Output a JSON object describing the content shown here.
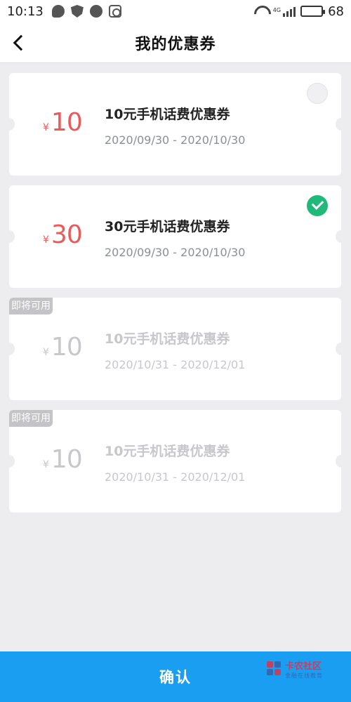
{
  "status_bar": {
    "time": "10:13",
    "net_type": "4G",
    "battery": "68",
    "battery_level": 0.68,
    "icons": [
      "message-bubble-icon",
      "shield-icon",
      "chat-dots-icon",
      "target-icon"
    ]
  },
  "nav": {
    "title": "我的优惠券",
    "back_icon": "chevron-left-icon"
  },
  "coupons": [
    {
      "currency": "¥",
      "amount": "10",
      "title": "10元手机话费优惠券",
      "date_range": "2020/09/30 - 2020/10/30",
      "state": "unselected"
    },
    {
      "currency": "¥",
      "amount": "30",
      "title": "30元手机话费优惠券",
      "date_range": "2020/09/30 - 2020/10/30",
      "state": "selected"
    },
    {
      "currency": "¥",
      "amount": "10",
      "title": "10元手机话费优惠券",
      "date_range": "2020/10/31 - 2020/12/01",
      "state": "disabled",
      "badge": "即将可用"
    },
    {
      "currency": "¥",
      "amount": "10",
      "title": "10元手机话费优惠券",
      "date_range": "2020/10/31 - 2020/12/01",
      "state": "disabled",
      "badge": "即将可用"
    }
  ],
  "confirm": {
    "label": "确认"
  },
  "watermark": {
    "name": "卡农社区",
    "sub": "金融在线教育"
  },
  "colors": {
    "accent_blue": "#1a9ef2",
    "amount_red": "#e95b5b",
    "check_green": "#1fb97a",
    "disabled_gray": "#c8c8cc"
  }
}
